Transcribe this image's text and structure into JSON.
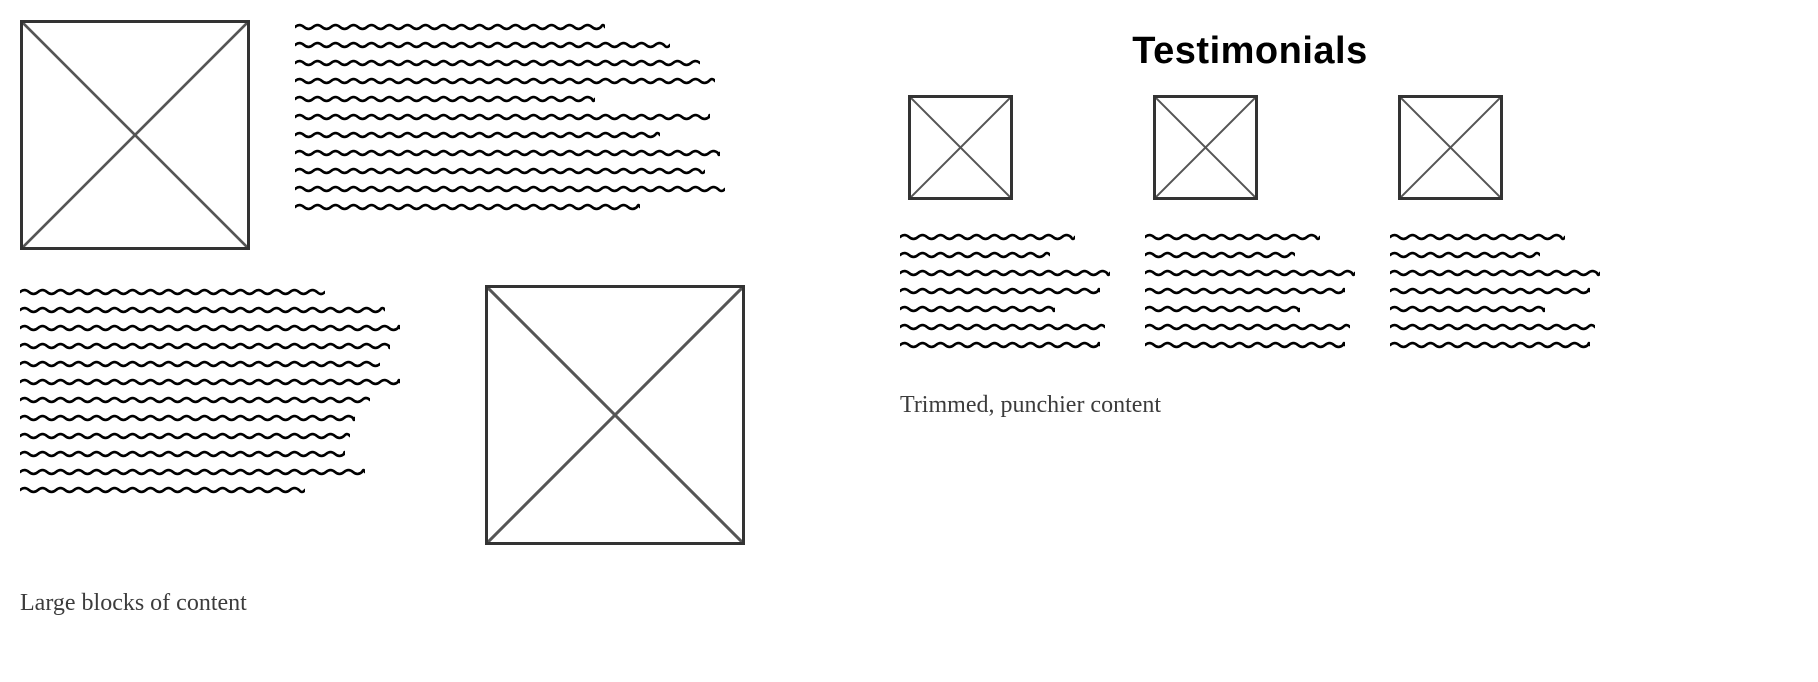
{
  "left": {
    "rows": [
      {
        "image_position": "left",
        "image_size": "large",
        "text_lines": 11,
        "text_widths": [
          310,
          375,
          405,
          420,
          300,
          415,
          365,
          425,
          410,
          430,
          345
        ]
      },
      {
        "image_position": "right",
        "image_size": "medium",
        "text_lines": 12,
        "text_widths": [
          305,
          365,
          380,
          370,
          360,
          380,
          350,
          335,
          330,
          325,
          345,
          285
        ]
      }
    ],
    "caption": "Large blocks of content"
  },
  "right": {
    "heading": "Testimonials",
    "columns": [
      {
        "text_lines": 7,
        "text_widths": [
          175,
          150,
          210,
          200,
          155,
          205,
          200
        ]
      },
      {
        "text_lines": 7,
        "text_widths": [
          175,
          150,
          210,
          200,
          155,
          205,
          200
        ]
      },
      {
        "text_lines": 7,
        "text_widths": [
          175,
          150,
          210,
          200,
          155,
          205,
          200
        ]
      }
    ],
    "caption": "Trimmed, punchier content"
  }
}
